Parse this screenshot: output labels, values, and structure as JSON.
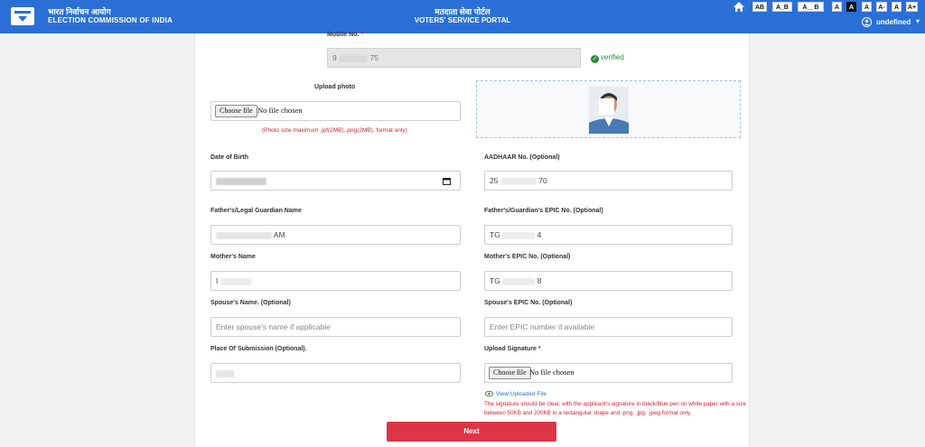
{
  "header": {
    "org_hindi": "भारत निर्वाचन आयोग",
    "org_english": "ELECTION COMMISSION OF INDIA",
    "portal_hindi": "मतदाता सेवा पोर्टल",
    "portal_english": "VOTERS' SERVICE PORTAL",
    "accessibility": [
      "AB",
      "A_B",
      "A__B",
      "A",
      "A",
      "A",
      "A-",
      "A",
      "A+"
    ],
    "user_name": "undefined"
  },
  "form": {
    "mobile": {
      "label": "Mobile No.",
      "required_mark": "*",
      "value_start": "9",
      "value_end": "75",
      "status": "verified"
    },
    "photo": {
      "label": "Upload photo",
      "button": "Choose file",
      "file_text": "No file chosen",
      "hint": "(Photo size maximum .jpf(2MB),.png(2MB), format only)"
    },
    "dob": {
      "label": "Date of Birth"
    },
    "aadhaar": {
      "label": "AADHAAR No. (Optional)",
      "value_start": "25",
      "value_end": "70"
    },
    "father_name": {
      "label": "Father's/Legal Guardian Name",
      "value_end": "AM"
    },
    "father_epic": {
      "label": "Father's/Guardian's EPIC No. (Optional)",
      "value_start": "TG",
      "value_end": "4"
    },
    "mother_name": {
      "label": "Mother's Name",
      "value_start": "I"
    },
    "mother_epic": {
      "label": "Mother's EPIC No. (Optional)",
      "value_start": "TG",
      "value_end": "8"
    },
    "spouse_name": {
      "label": "Spouse's Name. (Optional)",
      "placeholder": "Enter spouse's name if applicable"
    },
    "spouse_epic": {
      "label": "Spouse's EPIC No. (Optional)",
      "placeholder": "Enter EPIC number if available"
    },
    "place": {
      "label": "Place Of Submission (Optional)."
    },
    "signature": {
      "label": "Upload Signature",
      "required_mark": "*",
      "button": "Choose file",
      "file_text": "No file chosen",
      "view_link": "View Uploaded File",
      "note": "The signature should be clear, with the applicant's signature in black/blue pen on white paper with a size between 50KB and 200KB in a rectangular shape and .png, .jpg, .jpeg format only."
    },
    "next": "Next"
  },
  "colors": {
    "header": "#2a6fd6",
    "verified": "#2e8b3a",
    "error": "#d21f2f",
    "next": "#dc3545"
  }
}
